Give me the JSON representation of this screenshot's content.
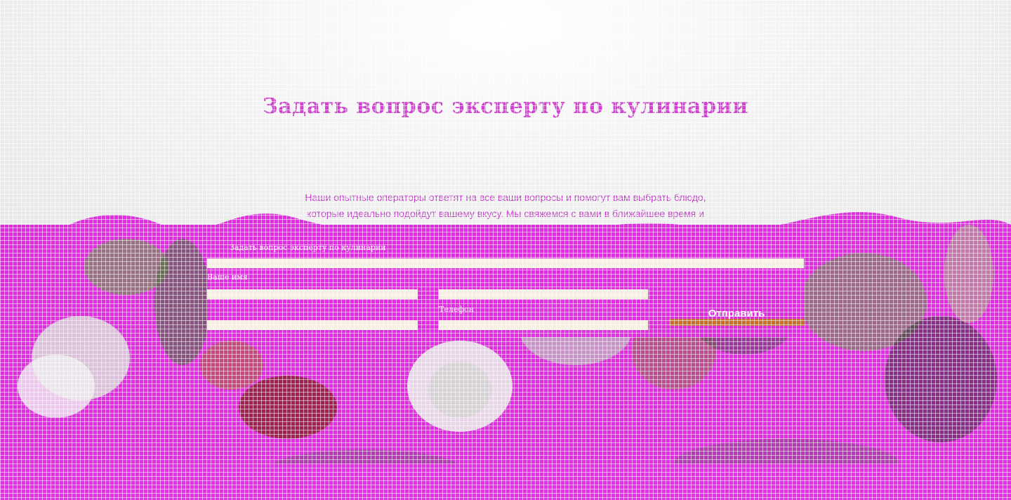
{
  "hero": {
    "title": "Задать вопрос эксперту по кулинарии",
    "description": "Наши опытные операторы ответят на все ваши вопросы и помогут вам выбрать блюдо, которые идеально подойдут вашему вкусу. Мы свяжемся с вами в ближайшее время и обсудим ваши пожелания."
  },
  "form": {
    "question_label": "Задать вопрос эксперту по кулинарии",
    "question_placeholder": "",
    "name_label": "Ваше имя",
    "name_placeholder": "",
    "phone_label": "Телефон",
    "phone_placeholder": "",
    "submit_label": "Отправить"
  },
  "colors": {
    "accent": "#d43fd4",
    "panel": "#e828e8",
    "button_bar": "#c7702a",
    "field_background": "#f6efe0"
  }
}
